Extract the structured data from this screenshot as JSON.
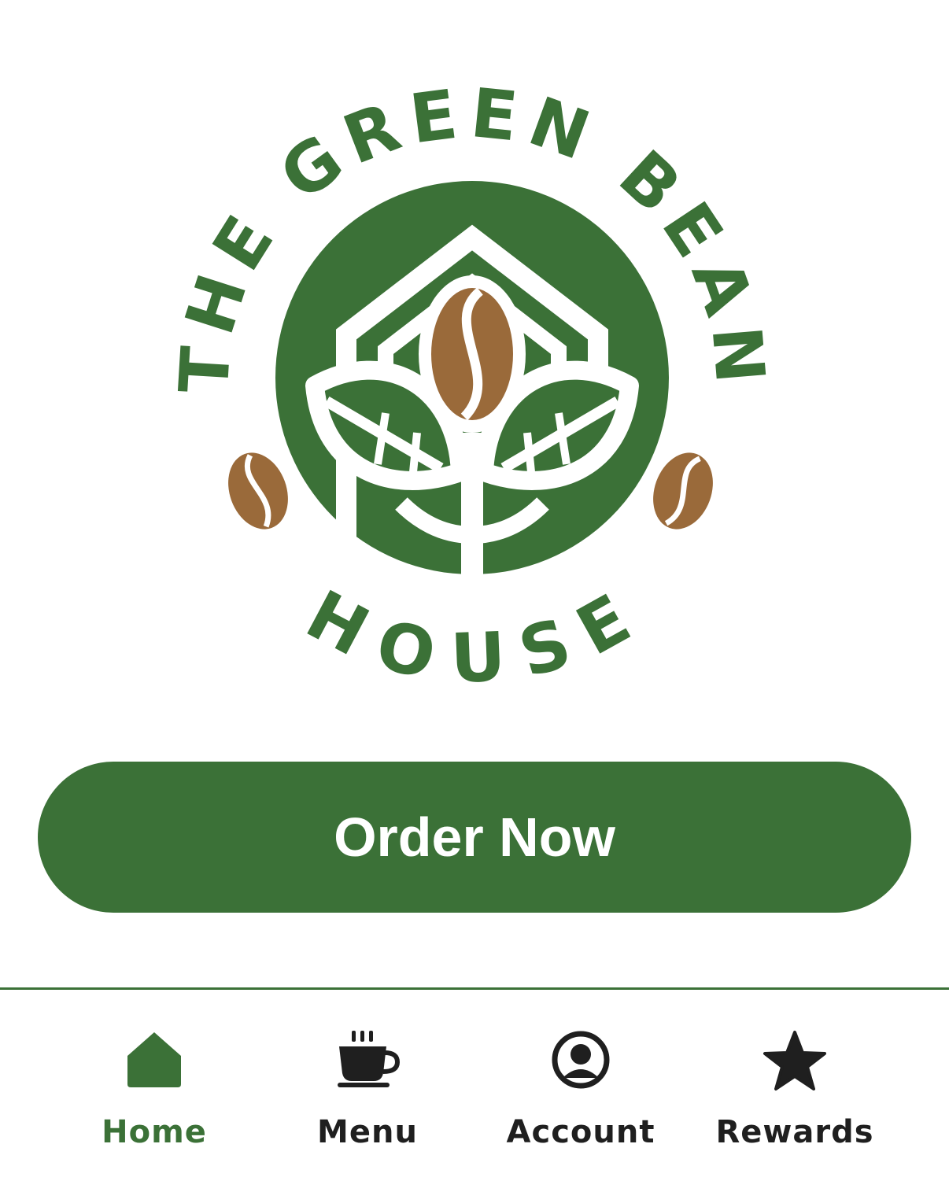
{
  "logo": {
    "name": "the-green-bean-house-logo",
    "arc_top": "THE GREEN BEAN",
    "arc_bottom": "HOUSE",
    "colors": {
      "green": "#3b7137",
      "bean": "#9a6a3a",
      "white": "#ffffff"
    }
  },
  "order_button": {
    "label": "Order Now",
    "color": "#3b7137"
  },
  "tabbar": {
    "active_color": "#3b7137",
    "inactive_color": "#1f1f1f",
    "items": [
      {
        "label": "Home",
        "icon": "home-icon",
        "active": true
      },
      {
        "label": "Menu",
        "icon": "coffee-cup-icon",
        "active": false
      },
      {
        "label": "Account",
        "icon": "account-circle-icon",
        "active": false
      },
      {
        "label": "Rewards",
        "icon": "star-icon",
        "active": false
      }
    ]
  }
}
